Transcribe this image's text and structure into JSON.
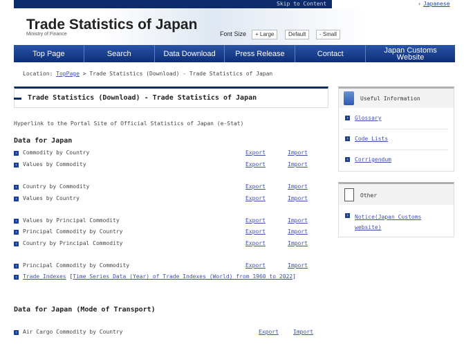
{
  "header": {
    "skip": "Skip to Content",
    "japanese": "Japanese",
    "title": "Trade Statistics of Japan",
    "subtitle": "Ministry of Finance",
    "font_size": "Font Size",
    "large": "+ Large",
    "default": "Default",
    "small": "- Small"
  },
  "nav": [
    "Top Page",
    "Search",
    "Data Download",
    "Press Release",
    "Contact",
    "Japan Customs Website"
  ],
  "location": {
    "label": "Location: ",
    "top": "TopPage",
    "rest": " > Trade Statistics (Download) - Trade Statistics of Japan"
  },
  "main": {
    "title": "Trade Statistics (Download) - Trade Statistics of Japan",
    "estat": "Hyperlink to the Portal Site of Official Statistics of Japan (e-Stat)",
    "section1": "Data for Japan",
    "export": "Export",
    "import": "Import",
    "rows": [
      "Commodity by Country",
      "Values by Commodity",
      "Country by Commodity",
      "Values by Country",
      "Values by Principal Commodity",
      "Principal Commodity by Country",
      "Country by Principal Commodity",
      "Principal Commodity by Commodity"
    ],
    "indexes": "Trade Indexes",
    "indexes_link": "Time Series Data (Year) of Trade Indexes (World) from 1960 to 2022",
    "section2": "Data for Japan (Mode of Transport)",
    "air": "Air Cargo Commodity by Country"
  },
  "sidebar": {
    "useful": "Useful Information",
    "useful_items": [
      "Glossary",
      "Code Lists",
      "Corrigendum"
    ],
    "other": "Other",
    "other_items": [
      "Notice(Japan Customs website)"
    ]
  }
}
